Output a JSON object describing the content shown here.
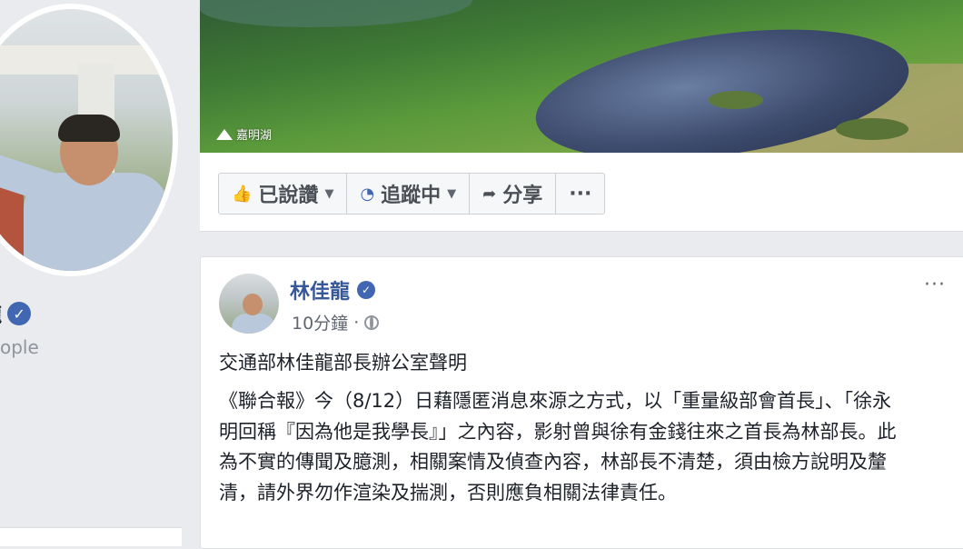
{
  "profile": {
    "name": "龍",
    "category": "ople"
  },
  "cover": {
    "location": "嘉明湖"
  },
  "actions": {
    "like_label": "已說讚",
    "follow_label": "追蹤中",
    "share_label": "分享",
    "more_label": "···"
  },
  "post": {
    "author": "林佳龍",
    "time": "10分鐘",
    "separator": "·",
    "options": "···",
    "headline": "交通部林佳龍部長辦公室聲明",
    "body": "《聯合報》今（8/12）日藉隱匿消息來源之方式，以「重量級部會首長」、「徐永明回稱『因為他是我學長』」之內容，影射曾與徐有金錢往來之首長為林部長。此為不實的傳聞及臆測，相關案情及偵查內容，林部長不清楚，須由檢方說明及釐清，請外界勿作渲染及揣測，否則應負相關法律責任。"
  },
  "colors": {
    "accent": "#4267b2",
    "author_link": "#365899",
    "page_bg": "#e9ebee"
  },
  "icons": [
    "mountain-icon",
    "thumbs-up-icon",
    "rss-icon",
    "share-arrow-icon",
    "globe-icon",
    "verified-check-icon"
  ]
}
